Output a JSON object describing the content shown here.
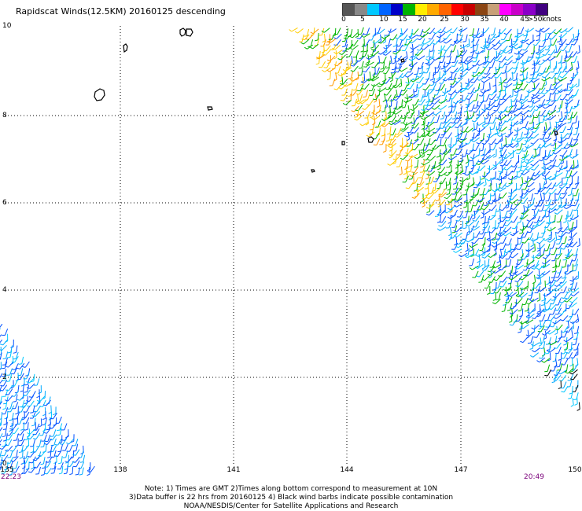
{
  "title": "Rapidscat Winds(12.5KM) 20160125 descending",
  "colorbar": {
    "colors": [
      "#555555",
      "#888888",
      "#00c8ff",
      "#0064ff",
      "#0000c8",
      "#00b400",
      "#ffee00",
      "#ffaa00",
      "#ff6400",
      "#ff0000",
      "#c80000",
      "#8b4513",
      "#c8a078",
      "#ff00ff",
      "#c800c8",
      "#8a00c8",
      "#400080"
    ],
    "labels": [
      "0",
      "5",
      "10",
      "15",
      "20",
      "25",
      "30",
      "35",
      "40",
      "45",
      ">50"
    ],
    "unit": "knots"
  },
  "axes": {
    "lat_labels": [
      "10",
      "8",
      "6",
      "4",
      "2",
      "0"
    ],
    "lon_labels": [
      "135",
      "138",
      "141",
      "144",
      "147",
      "150"
    ]
  },
  "times": {
    "left": "22:23",
    "right": "20:49"
  },
  "notes": {
    "line1": "Note: 1) Times are GMT 2)Times along bottom correspond to measurement at 10N",
    "line2": "3)Data buffer is 22 hrs from 20160125 4) Black wind barbs indicate possible contamination",
    "line3": "NOAA/NESDIS/Center for Satellite Applications and Research"
  }
}
